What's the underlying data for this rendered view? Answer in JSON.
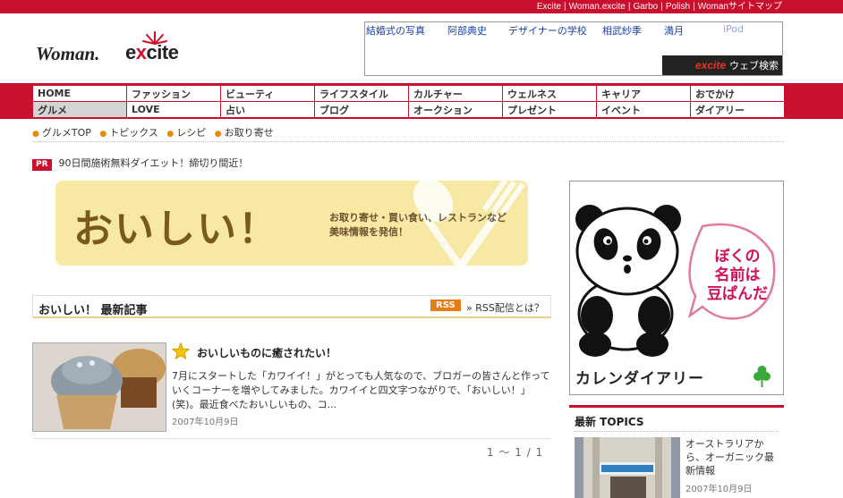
{
  "topbar": {
    "links": [
      "Excite",
      "Woman.excite",
      "Garbo",
      "Polish",
      "Womanサイトマップ"
    ],
    "separator": "|"
  },
  "logo": {
    "part1": "Woman.",
    "part2_e": "e",
    "part2_x": "x",
    "part2_rest": "cite"
  },
  "search": {
    "links": [
      "結婚式の写真",
      "阿部典史",
      "デザイナーの学校",
      "相武紗季",
      "満月",
      "iPod"
    ],
    "button_brand": "excite",
    "button_label": "ウェブ検索"
  },
  "nav": {
    "row1": [
      "HOME",
      "ファッション",
      "ビューティ",
      "ライフスタイル",
      "カルチャー",
      "ウェルネス",
      "キャリア",
      "おでかけ"
    ],
    "row2": [
      "グルメ",
      "LOVE",
      "占い",
      "ブログ",
      "オークション",
      "プレゼント",
      "イベント",
      "ダイアリー"
    ],
    "active": "グルメ"
  },
  "subnav": [
    "グルメTOP",
    "トピックス",
    "レシピ",
    "お取り寄せ"
  ],
  "pr": {
    "badge": "PR",
    "text": "90日間施術無料ダイエット！締切り間近！"
  },
  "banner": {
    "title": "おいしい！",
    "tagline1": "お取り寄せ・買い食い、レストランなど",
    "tagline2": "美味情報を発信！"
  },
  "section": {
    "title": "おいしい！ 最新記事",
    "rss": "RSS",
    "rss_info": "» RSS配信とは？"
  },
  "article": {
    "title": "おいしいものに癒されたい！",
    "body": "7月にスタートした「カワイイ！」がとっても人気なので、ブロガーの皆さんと作っていくコーナーを増やしてみました。カワイイと四文字つながりで、「おいしい！」(笑)。最近食べたおいしいもの、コ...",
    "date": "2007年10月9日"
  },
  "pager": "1 〜 1 / 1",
  "ad": {
    "bubble": [
      "ぼくの",
      "名前は",
      "豆ぱんだ"
    ],
    "footer": "カレンダイアリー"
  },
  "topics": {
    "heading": "最新 TOPICS",
    "item_text": "オーストラリアから、オーガニック最新情報",
    "item_date": "2007年10月9日"
  },
  "colors": {
    "brand_red": "#c8102e",
    "link_blue": "#1a3fa8",
    "rss_orange": "#e87c14"
  }
}
